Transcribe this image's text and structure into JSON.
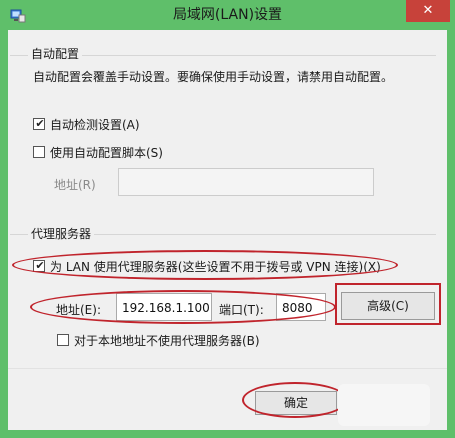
{
  "window": {
    "title": "局域网(LAN)设置",
    "close_glyph": "✕"
  },
  "auto_config": {
    "group_title": "自动配置",
    "description": "自动配置会覆盖手动设置。要确保使用手动设置，请禁用自动配置。",
    "auto_detect": {
      "label": "自动检测设置(A)",
      "checked": true
    },
    "use_script": {
      "label": "使用自动配置脚本(S)",
      "checked": false
    },
    "address_label": "地址(R)",
    "address_value": ""
  },
  "proxy": {
    "group_title": "代理服务器",
    "use_proxy": {
      "label": "为 LAN 使用代理服务器(这些设置不用于拨号或 VPN 连接)(X)",
      "checked": true
    },
    "address_label": "地址(E):",
    "address_value": "192.168.1.100",
    "port_label": "端口(T):",
    "port_value": "8080",
    "advanced_label": "高级(C)",
    "bypass_local": {
      "label": "对于本地地址不使用代理服务器(B)",
      "checked": false
    }
  },
  "footer": {
    "ok_label": "确定"
  },
  "colors": {
    "frame": "#5fbf6a",
    "annotation_red": "#c0242c",
    "close": "#c7423a"
  },
  "check_glyph": "✔"
}
